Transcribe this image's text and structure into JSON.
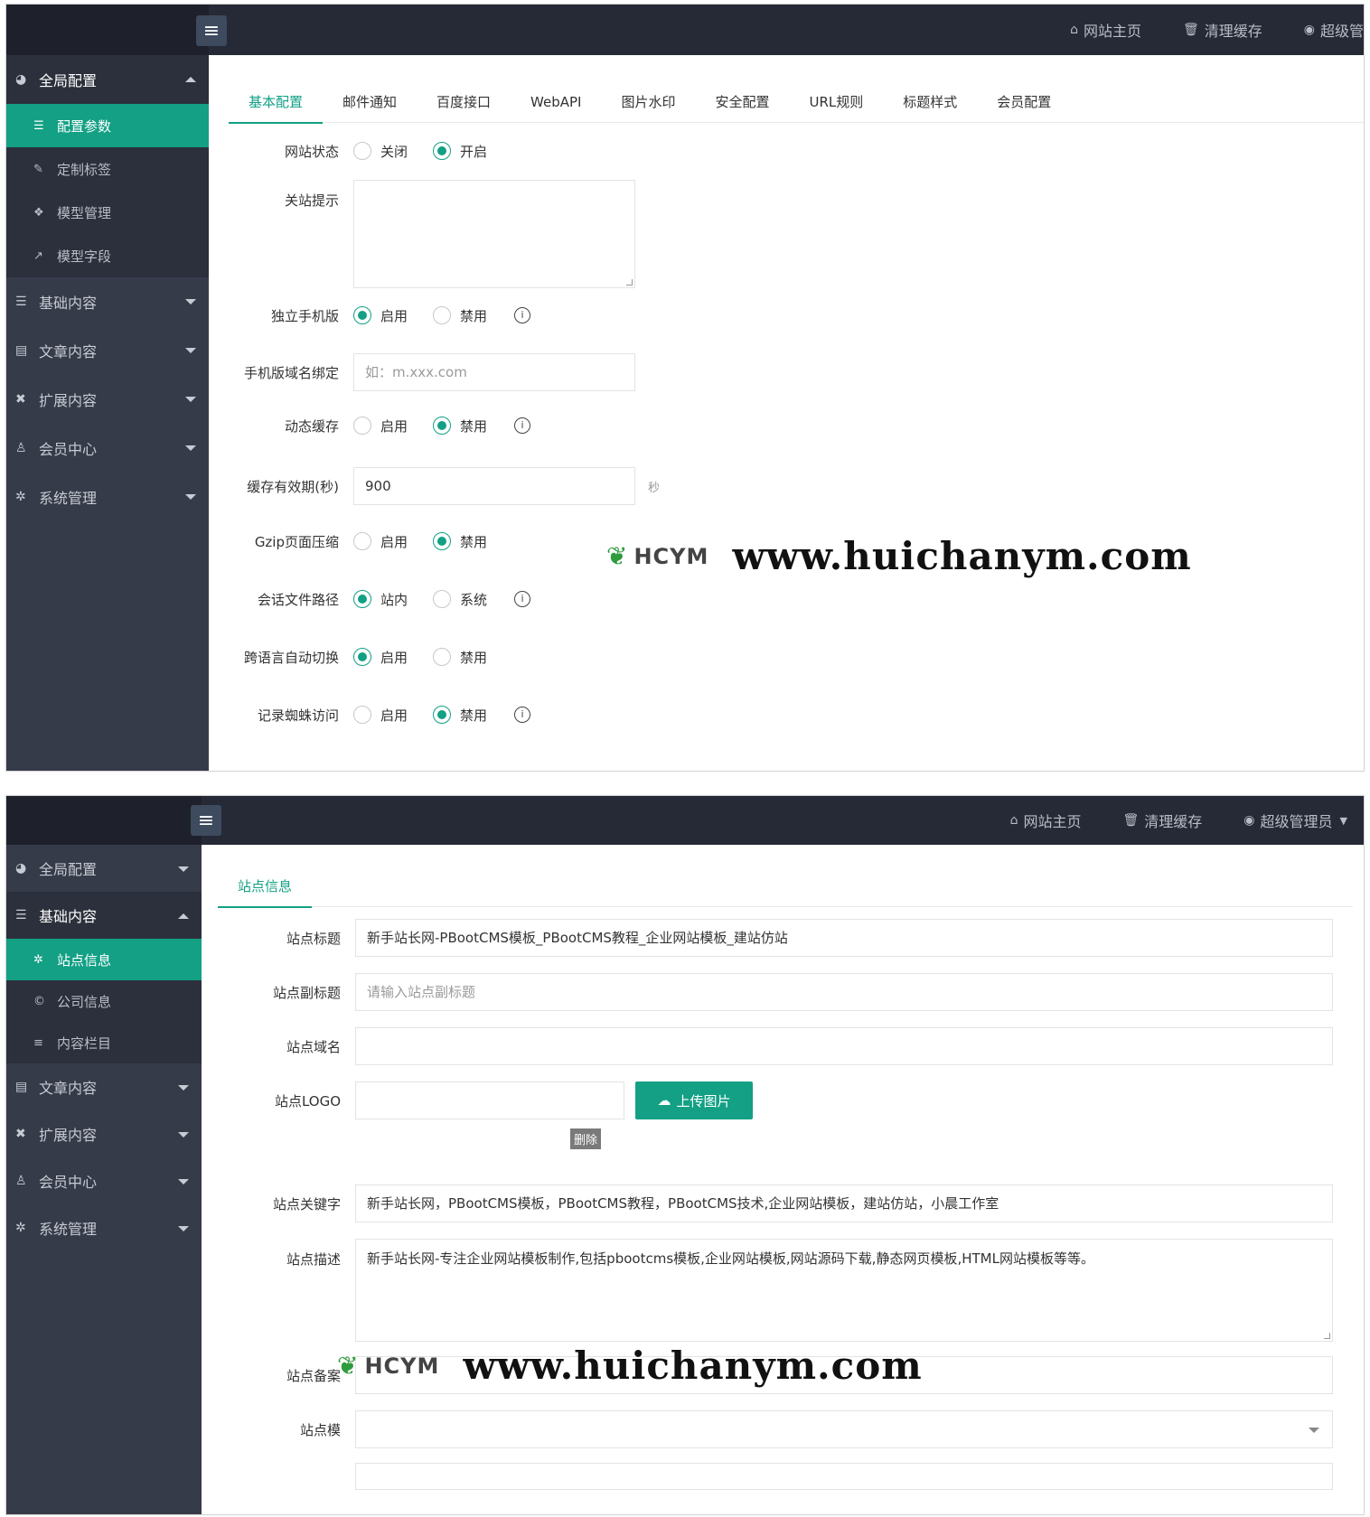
{
  "colors": {
    "accent": "#13a085",
    "topbar": "#262a36",
    "sidebar": "#363b4a"
  },
  "panel1": {
    "topnav": [
      {
        "icon": "home-icon",
        "label": "网站主页"
      },
      {
        "icon": "trash-icon",
        "label": "清理缓存"
      },
      {
        "icon": "user-icon",
        "label": "超级管"
      }
    ],
    "sidebar": {
      "group_open": {
        "icon": "globe-icon",
        "label": "全局配置"
      },
      "sub": [
        {
          "icon": "sliders-icon",
          "label": "配置参数"
        },
        {
          "icon": "wrench-icon",
          "label": "定制标签"
        },
        {
          "icon": "cube-icon",
          "label": "模型管理"
        },
        {
          "icon": "external-link-icon",
          "label": "模型字段"
        }
      ],
      "groups": [
        {
          "icon": "sliders-icon",
          "label": "基础内容"
        },
        {
          "icon": "file-icon",
          "label": "文章内容"
        },
        {
          "icon": "expand-icon",
          "label": "扩展内容"
        },
        {
          "icon": "user-icon",
          "label": "会员中心"
        },
        {
          "icon": "gear-icon",
          "label": "系统管理"
        }
      ]
    },
    "tabs": [
      "基本配置",
      "邮件通知",
      "百度接口",
      "WebAPI",
      "图片水印",
      "安全配置",
      "URL规则",
      "标题样式",
      "会员配置"
    ],
    "form": {
      "site_status": {
        "label": "网站状态",
        "opt1": "关闭",
        "opt2": "开启"
      },
      "close_tip": {
        "label": "关站提示"
      },
      "mobile": {
        "label": "独立手机版",
        "opt1": "启用",
        "opt2": "禁用"
      },
      "mobile_domain": {
        "label": "手机版域名绑定",
        "placeholder": "如：m.xxx.com"
      },
      "dynamic_cache": {
        "label": "动态缓存",
        "opt1": "启用",
        "opt2": "禁用"
      },
      "cache_time": {
        "label": "缓存有效期(秒)",
        "value": "900",
        "suffix": "秒"
      },
      "gzip": {
        "label": "Gzip页面压缩",
        "opt1": "启用",
        "opt2": "禁用"
      },
      "session_path": {
        "label": "会话文件路径",
        "opt1": "站内",
        "opt2": "系统"
      },
      "lang_switch": {
        "label": "跨语言自动切换",
        "opt1": "启用",
        "opt2": "禁用"
      },
      "spider_log": {
        "label": "记录蜘蛛访问",
        "opt1": "启用",
        "opt2": "禁用"
      }
    },
    "help_glyph": "i"
  },
  "panel2": {
    "topnav": [
      {
        "icon": "home-icon",
        "label": "网站主页"
      },
      {
        "icon": "trash-icon",
        "label": "清理缓存"
      },
      {
        "icon": "user-icon",
        "label": "超级管理员"
      }
    ],
    "sidebar": {
      "group_top": {
        "icon": "globe-icon",
        "label": "全局配置"
      },
      "group_open": {
        "icon": "sliders-icon",
        "label": "基础内容"
      },
      "sub": [
        {
          "icon": "gear-icon",
          "label": "站点信息"
        },
        {
          "icon": "copyright-icon",
          "label": "公司信息"
        },
        {
          "icon": "list-icon",
          "label": "内容栏目"
        }
      ],
      "groups": [
        {
          "icon": "file-icon",
          "label": "文章内容"
        },
        {
          "icon": "expand-icon",
          "label": "扩展内容"
        },
        {
          "icon": "user-icon",
          "label": "会员中心"
        },
        {
          "icon": "gear-icon",
          "label": "系统管理"
        }
      ]
    },
    "tabs": [
      "站点信息"
    ],
    "form": {
      "title": {
        "label": "站点标题",
        "value": "新手站长网-PBootCMS模板_PBootCMS教程_企业网站模板_建站仿站"
      },
      "subtitle": {
        "label": "站点副标题",
        "placeholder": "请输入站点副标题"
      },
      "domain": {
        "label": "站点域名",
        "value": ""
      },
      "logo": {
        "label": "站点LOGO",
        "upload": "上传图片",
        "delete": "删除"
      },
      "keywords": {
        "label": "站点关键字",
        "value": "新手站长网，PBootCMS模板，PBootCMS教程，PBootCMS技术,企业网站模板，建站仿站，小晨工作室"
      },
      "description": {
        "label": "站点描述",
        "value": "新手站长网-专注企业网站模板制作,包括pbootcms模板,企业网站模板,网站源码下载,静态网页模板,HTML网站模板等等。"
      },
      "icp": {
        "label": "站点备案",
        "value": ""
      },
      "template": {
        "label": "站点模"
      }
    }
  },
  "watermark": {
    "logo": "HCYM",
    "url": "www.huichanym.com"
  }
}
